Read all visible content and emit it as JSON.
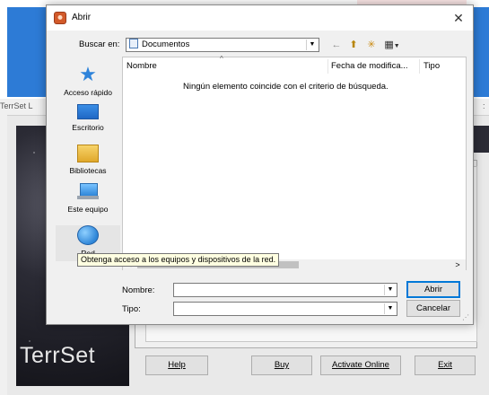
{
  "background_app": {
    "title_fragment": "TerrSet L",
    "brand": "TerrSet",
    "buttons": [
      "Help",
      "Buy",
      "Activate Online",
      "Exit"
    ]
  },
  "dialog": {
    "title": "Abrir",
    "look_in_label": "Buscar en:",
    "look_in_value": "Documentos",
    "places": [
      "Acceso rápido",
      "Escritorio",
      "Bibliotecas",
      "Este equipo",
      "Red"
    ],
    "columns": [
      "Nombre",
      "Fecha de modifica...",
      "Tipo"
    ],
    "empty_message": "Ningún elemento coincide con el criterio de búsqueda.",
    "tooltip": "Obtenga acceso a los equipos y dispositivos de la red.",
    "filename_label": "Nombre:",
    "filename_value": "",
    "filetype_label": "Tipo:",
    "filetype_value": "",
    "open_button": "Abrir",
    "cancel_button": "Cancelar"
  },
  "icons": {
    "back": "←",
    "up_folder": "⬆",
    "new_folder": "✳",
    "views": "▦",
    "dropdown": "▼",
    "close": "✕",
    "sort_up": "^",
    "scroll_left": "<",
    "scroll_right": ">"
  },
  "colors": {
    "accent": "#0078d7",
    "tooltip_bg": "#ffffe1"
  }
}
